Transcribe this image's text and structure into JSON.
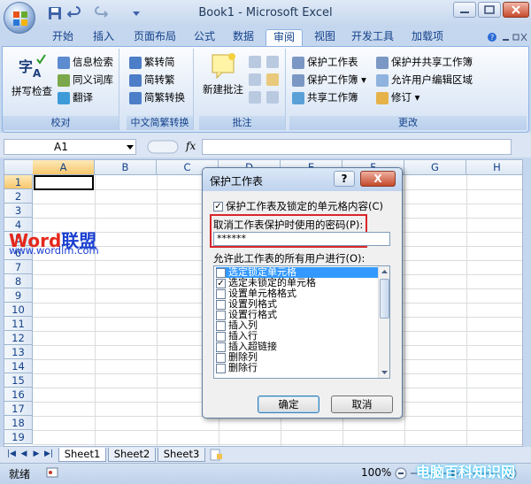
{
  "app": {
    "title": "Book1 - Microsoft Excel"
  },
  "tabs": [
    "开始",
    "插入",
    "页面布局",
    "公式",
    "数据",
    "审阅",
    "视图",
    "开发工具",
    "加载项"
  ],
  "active_tab": "审阅",
  "ribbon": {
    "proofing": {
      "spell": "拼写检查",
      "research": "信息检索",
      "thesaurus": "同义词库",
      "translate": "翻译",
      "label": "校对"
    },
    "chinese": {
      "to_simplified": "繁转简",
      "to_traditional": "简转繁",
      "convert": "简繁转换",
      "label": "中文简繁转换"
    },
    "comments": {
      "new": "新建批注",
      "label": "批注"
    },
    "changes": {
      "protect_sheet": "保护工作表",
      "protect_workbook": "保护工作簿",
      "share_workbook": "共享工作簿",
      "protect_share": "保护并共享工作簿",
      "allow_edit": "允许用户编辑区域",
      "track": "修订",
      "label": "更改"
    }
  },
  "formula_bar": {
    "name_box": "A1",
    "fx": "fx"
  },
  "grid": {
    "columns": [
      "A",
      "B",
      "C",
      "D",
      "E",
      "F",
      "G",
      "H"
    ],
    "rows": [
      "1",
      "2",
      "3",
      "4",
      "5",
      "6",
      "7",
      "8",
      "9",
      "10",
      "11",
      "12",
      "13",
      "14",
      "15",
      "16",
      "17",
      "18",
      "19"
    ]
  },
  "sheets": [
    "Sheet1",
    "Sheet2",
    "Sheet3"
  ],
  "status": {
    "ready": "就绪",
    "zoom": "100%"
  },
  "dialog": {
    "title": "保护工作表",
    "help": "?",
    "close": "X",
    "protect_contents": "保护工作表及锁定的单元格内容(C)",
    "password_label": "取消工作表保护时使用的密码(P):",
    "password_value": "******",
    "allow_label": "允许此工作表的所有用户进行(O):",
    "permissions": [
      {
        "label": "选定锁定单元格",
        "checked": true
      },
      {
        "label": "选定未锁定的单元格",
        "checked": true
      },
      {
        "label": "设置单元格格式",
        "checked": false
      },
      {
        "label": "设置列格式",
        "checked": false
      },
      {
        "label": "设置行格式",
        "checked": false
      },
      {
        "label": "插入列",
        "checked": false
      },
      {
        "label": "插入行",
        "checked": false
      },
      {
        "label": "插入超链接",
        "checked": false
      },
      {
        "label": "删除列",
        "checked": false
      },
      {
        "label": "删除行",
        "checked": false
      }
    ],
    "ok": "确定",
    "cancel": "取消"
  },
  "watermark": {
    "brand_word": "Word",
    "brand_cn": "联盟",
    "url": "www.wordlm.com",
    "corner": "电脑百科知识网"
  },
  "colors": {
    "accent": "#15428b",
    "highlight": "#d9262b",
    "selection": "#3399ff"
  }
}
